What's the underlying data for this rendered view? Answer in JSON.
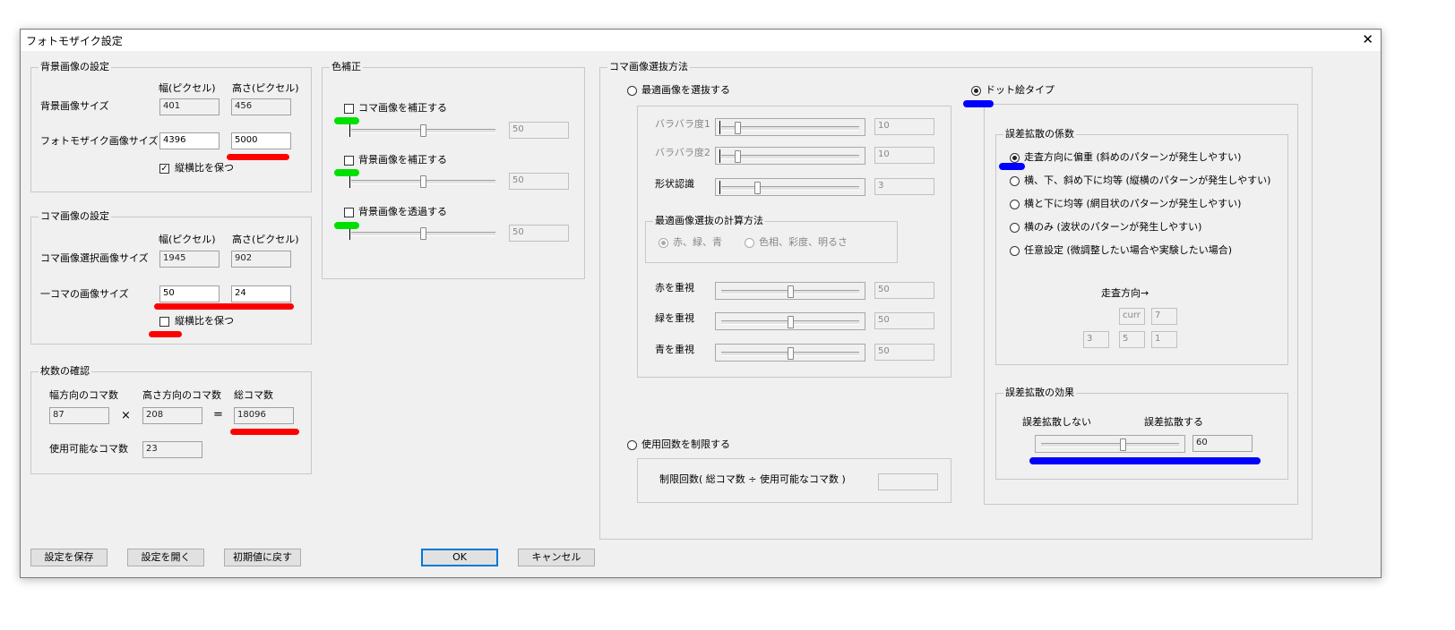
{
  "window": {
    "title": "フォトモザイク設定",
    "close_glyph": "✕"
  },
  "background_image": {
    "group_label": "背景画像の設定",
    "col_width": "幅(ピクセル)",
    "col_height": "高さ(ピクセル)",
    "bg_size_label": "背景画像サイズ",
    "bg_width": "401",
    "bg_height": "456",
    "mosaic_size_label": "フォトモザイク画像サイズ",
    "mosaic_width": "4396",
    "mosaic_height": "5000",
    "keep_aspect_label": "縦横比を保つ",
    "keep_aspect_checked": true
  },
  "tile_image": {
    "group_label": "コマ画像の設定",
    "col_width": "幅(ピクセル)",
    "col_height": "高さ(ピクセル)",
    "select_size_label": "コマ画像選択画像サイズ",
    "select_width": "1945",
    "select_height": "902",
    "tile_size_label": "一コマの画像サイズ",
    "tile_width": "50",
    "tile_height": "24",
    "keep_aspect_label": "縦横比を保つ",
    "keep_aspect_checked": false
  },
  "count_check": {
    "group_label": "枚数の確認",
    "horizontal_label": "幅方向のコマ数",
    "horizontal_value": "87",
    "times_symbol": "×",
    "vertical_label": "高さ方向のコマ数",
    "vertical_value": "208",
    "equals_symbol": "=",
    "total_label": "総コマ数",
    "total_value": "18096",
    "usable_label": "使用可能なコマ数",
    "usable_value": "23"
  },
  "color_correction": {
    "group_label": "色補正",
    "items": [
      {
        "label": "コマ画像を補正する",
        "checked": false,
        "value": "50",
        "level": 0.5
      },
      {
        "label": "背景画像を補正する",
        "checked": false,
        "value": "50",
        "level": 0.5
      },
      {
        "label": "背景画像を透過する",
        "checked": false,
        "value": "50",
        "level": 0.5
      }
    ]
  },
  "selection": {
    "group_label": "コマ画像選抜方法",
    "optimal_radio_label": "最適画像を選抜する",
    "params": [
      {
        "label": "バラバラ度1",
        "value": "10",
        "level": 0.1
      },
      {
        "label": "バラバラ度2",
        "value": "10",
        "level": 0.1
      },
      {
        "label": "形状認識",
        "value": "3",
        "level": 0.25
      }
    ],
    "calc_group_label": "最適画像選抜の計算方法",
    "calc_rgb_label": "赤、緑、青",
    "calc_hsv_label": "色相、彩度、明るさ",
    "weights": [
      {
        "label": "赤を重視",
        "value": "50",
        "level": 0.5
      },
      {
        "label": "緑を重視",
        "value": "50",
        "level": 0.5
      },
      {
        "label": "青を重視",
        "value": "50",
        "level": 0.5
      }
    ],
    "limit_radio_label": "使用回数を制限する",
    "limit_formula_label": "制限回数( 総コマ数 ÷ 使用可能なコマ数 )",
    "limit_value": "",
    "dot_radio_label": "ドット絵タイプ",
    "error_coef_group_label": "誤差拡散の係数",
    "coef_options": [
      {
        "label": "走査方向に偏重 (斜めのパターンが発生しやすい)",
        "selected": true
      },
      {
        "label": "横、下、斜め下に均等 (縦横のパターンが発生しやすい)",
        "selected": false
      },
      {
        "label": "横と下に均等 (網目状のパターンが発生しやすい)",
        "selected": false
      },
      {
        "label": "横のみ (波状のパターンが発生しやすい)",
        "selected": false
      },
      {
        "label": "任意設定 (微調整したい場合や実験したい場合)",
        "selected": false
      }
    ],
    "scan_direction_label": "走査方向→",
    "matrix": {
      "curr": "curr",
      "right": "7",
      "below_left": "3",
      "below": "5",
      "below_right": "1"
    },
    "error_effect_group_label": "誤差拡散の効果",
    "no_diffusion_label": "誤差拡散しない",
    "diffusion_label": "誤差拡散する",
    "effect_value": "60",
    "effect_level": 0.6
  },
  "buttons": {
    "save": "設定を保存",
    "open": "設定を開く",
    "reset": "初期値に戻す",
    "ok": "OK",
    "cancel": "キャンセル"
  },
  "colors": {
    "red_mark": "#ff0000",
    "green_mark": "#00e000",
    "blue_mark": "#0000ff",
    "dialog_bg": "#f0f0f0"
  }
}
